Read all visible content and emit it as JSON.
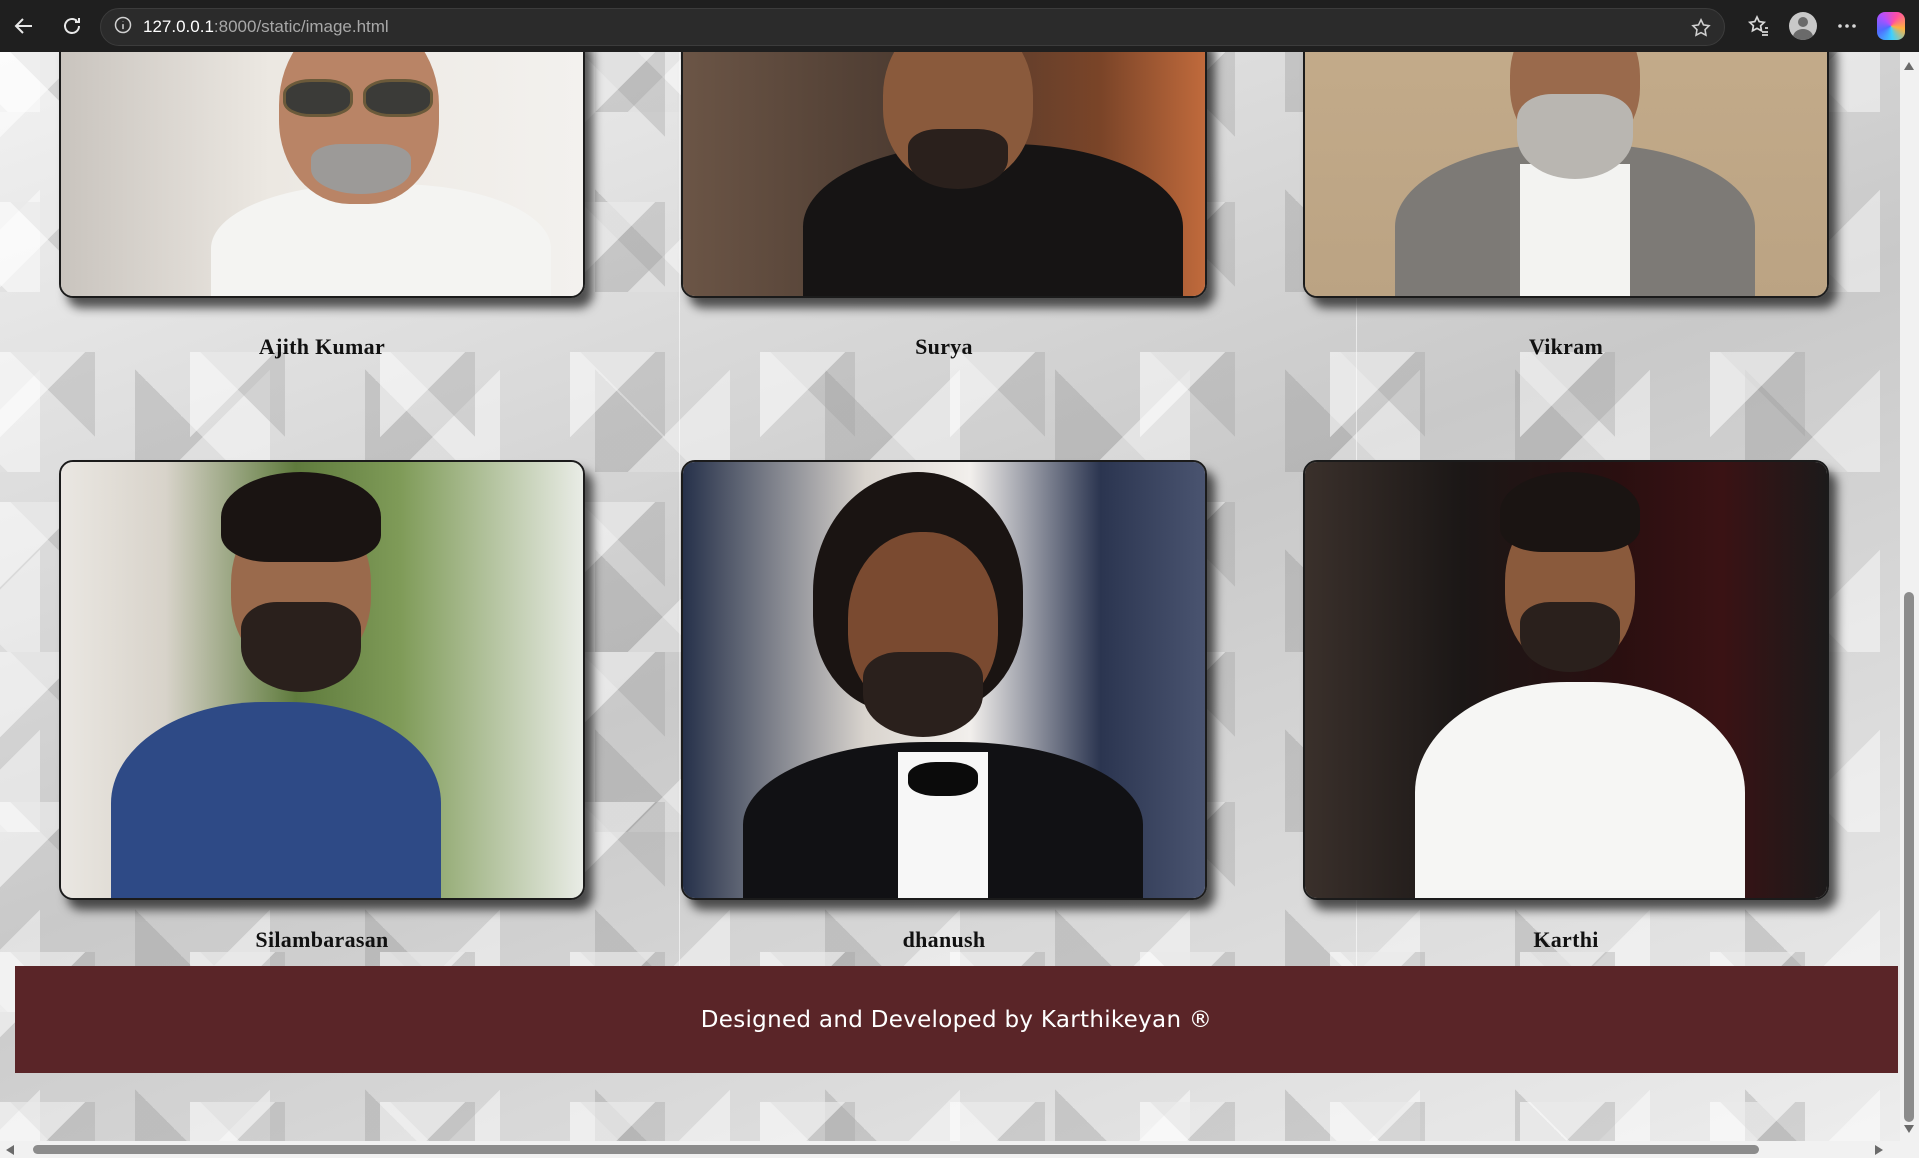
{
  "browser": {
    "url_host": "127.0.0.1",
    "url_path": ":8000/static/image.html",
    "back_icon": "back-arrow-icon",
    "reload_icon": "reload-icon",
    "info_icon": "site-info-icon",
    "favorite_icon": "star-icon",
    "favorites_icon": "favorites-icon",
    "profile_icon": "profile-icon",
    "menu_icon": "more-menu-icon",
    "copilot_icon": "copilot-icon"
  },
  "gallery": {
    "row1": [
      {
        "name": "Ajith Kumar"
      },
      {
        "name": "Surya"
      },
      {
        "name": "Vikram"
      }
    ],
    "row2": [
      {
        "name": "Silambarasan"
      },
      {
        "name": "dhanush"
      },
      {
        "name": "Karthi"
      }
    ]
  },
  "footer": {
    "text": "Designed and Developed by Karthikeyan ®",
    "background": "#5a2528"
  }
}
